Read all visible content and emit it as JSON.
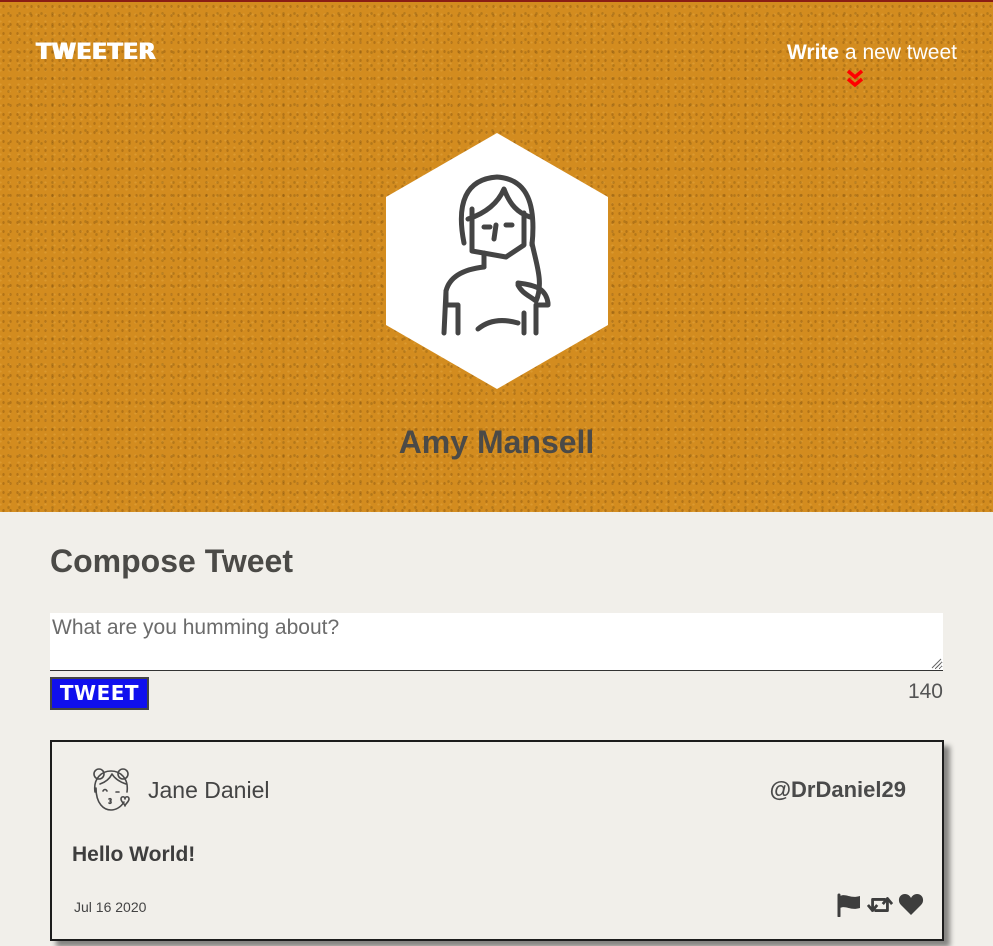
{
  "nav": {
    "brand": "TWEETER",
    "write_bold": "Write",
    "write_rest": " a new tweet"
  },
  "icons": {
    "chevrons": "double-chevron-down-icon",
    "profile_avatar": "woman-avatar-icon",
    "tweet_avatar": "girl-kiss-avatar-icon",
    "flag": "flag-icon",
    "retweet": "retweet-icon",
    "like": "heart-icon"
  },
  "profile": {
    "name": "Amy Mansell"
  },
  "compose": {
    "title": "Compose Tweet",
    "placeholder": "What are you humming about?",
    "button_label": "TWEET",
    "char_count": "140"
  },
  "tweets": [
    {
      "name": "Jane Daniel",
      "handle": "@DrDaniel29",
      "content": "Hello World!",
      "date": "Jul 16 2020"
    }
  ],
  "colors": {
    "header_bg": "#d38c1f",
    "page_bg": "#f1efea",
    "tweet_button": "#1010ee",
    "chevron": "#ff0000",
    "text_dark": "#4b4a47"
  }
}
